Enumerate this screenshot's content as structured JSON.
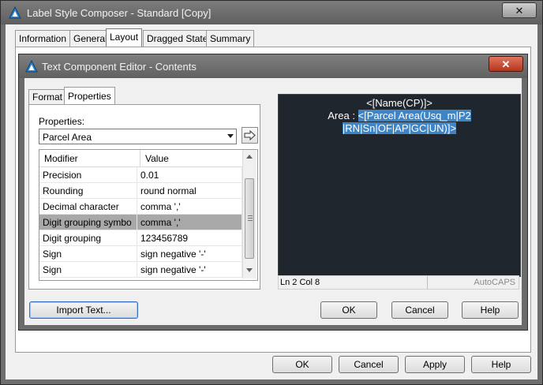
{
  "window": {
    "title": "Label Style Composer - Standard [Copy]",
    "close_label": "✕"
  },
  "tabs": [
    {
      "label": "Information"
    },
    {
      "label": "General"
    },
    {
      "label": "Layout"
    },
    {
      "label": "Dragged State"
    },
    {
      "label": "Summary"
    }
  ],
  "footer": {
    "ok": "OK",
    "cancel": "Cancel",
    "apply": "Apply",
    "help": "Help"
  },
  "editor": {
    "title": "Text Component Editor - Contents",
    "close_label": "✕",
    "tabs": [
      {
        "label": "Format"
      },
      {
        "label": "Properties"
      }
    ],
    "properties_label": "Properties:",
    "properties_value": "Parcel Area",
    "grid": {
      "columns": [
        "Modifier",
        "Value"
      ],
      "rows": [
        {
          "modifier": "Precision",
          "value": "0.01"
        },
        {
          "modifier": "Rounding",
          "value": "round normal"
        },
        {
          "modifier": "Decimal character",
          "value": "comma ','"
        },
        {
          "modifier": "Digit grouping symbo",
          "value": "comma ','"
        },
        {
          "modifier": "Digit grouping",
          "value": "123456789"
        },
        {
          "modifier": "Sign",
          "value": "sign negative '-'"
        },
        {
          "modifier": "Sign",
          "value": "sign negative '-'"
        }
      ],
      "selected_row": 3
    },
    "preview": {
      "line1": "<[Name(CP)]>",
      "line2_prefix": "Area : ",
      "line2_highlight": "<[Parcel Area(Usq_m|P2",
      "line3_highlight": "|RN|Sn|OF|AP|GC|UN)]>"
    },
    "status": {
      "position": "Ln 2 Col 8",
      "brand": "AutoCAPS"
    },
    "buttons": {
      "import": "Import Text...",
      "ok": "OK",
      "cancel": "Cancel",
      "help": "Help"
    }
  },
  "colors": {
    "preview_bg": "#20262d",
    "highlight": "#3d85c6",
    "selected_row": "#a8a8a8"
  }
}
